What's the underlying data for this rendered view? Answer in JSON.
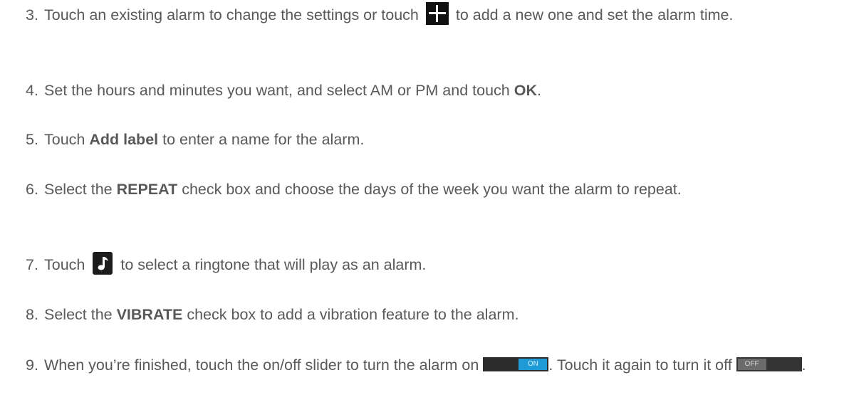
{
  "steps": [
    {
      "number": "3.",
      "a": "Touch an existing alarm to change the settings or touch",
      "icon": "plus-icon",
      "b": "to add a new one and set the alarm time."
    },
    {
      "number": "4.",
      "a": "Set the hours and minutes you want, and select AM or PM and touch ",
      "bold": "OK",
      "b": "."
    },
    {
      "number": "5.",
      "a": "Touch ",
      "bold": "Add label",
      "b": " to enter a name for the alarm."
    },
    {
      "number": "6.",
      "a": "Select the ",
      "bold": "REPEAT",
      "b": " check box and choose the days of the week you want the alarm to repeat."
    },
    {
      "number": "7.",
      "a": "Touch",
      "icon": "music-note-icon",
      "b": "to select a ringtone that will play as an alarm."
    },
    {
      "number": "8.",
      "a": "Select the ",
      "bold": "VIBRATE",
      "b": " check box to add a vibration feature to the alarm."
    },
    {
      "number": "9.",
      "a": "When you’re finished, touch the on/off slider to turn the alarm on",
      "toggle_on_label": "ON",
      "b": ". Touch it again to turn it off",
      "toggle_off_label": "OFF",
      "c": "."
    }
  ],
  "colors": {
    "text": "#595959",
    "toggle_on": "#1e9bd6",
    "icon_bg": "#111111"
  }
}
